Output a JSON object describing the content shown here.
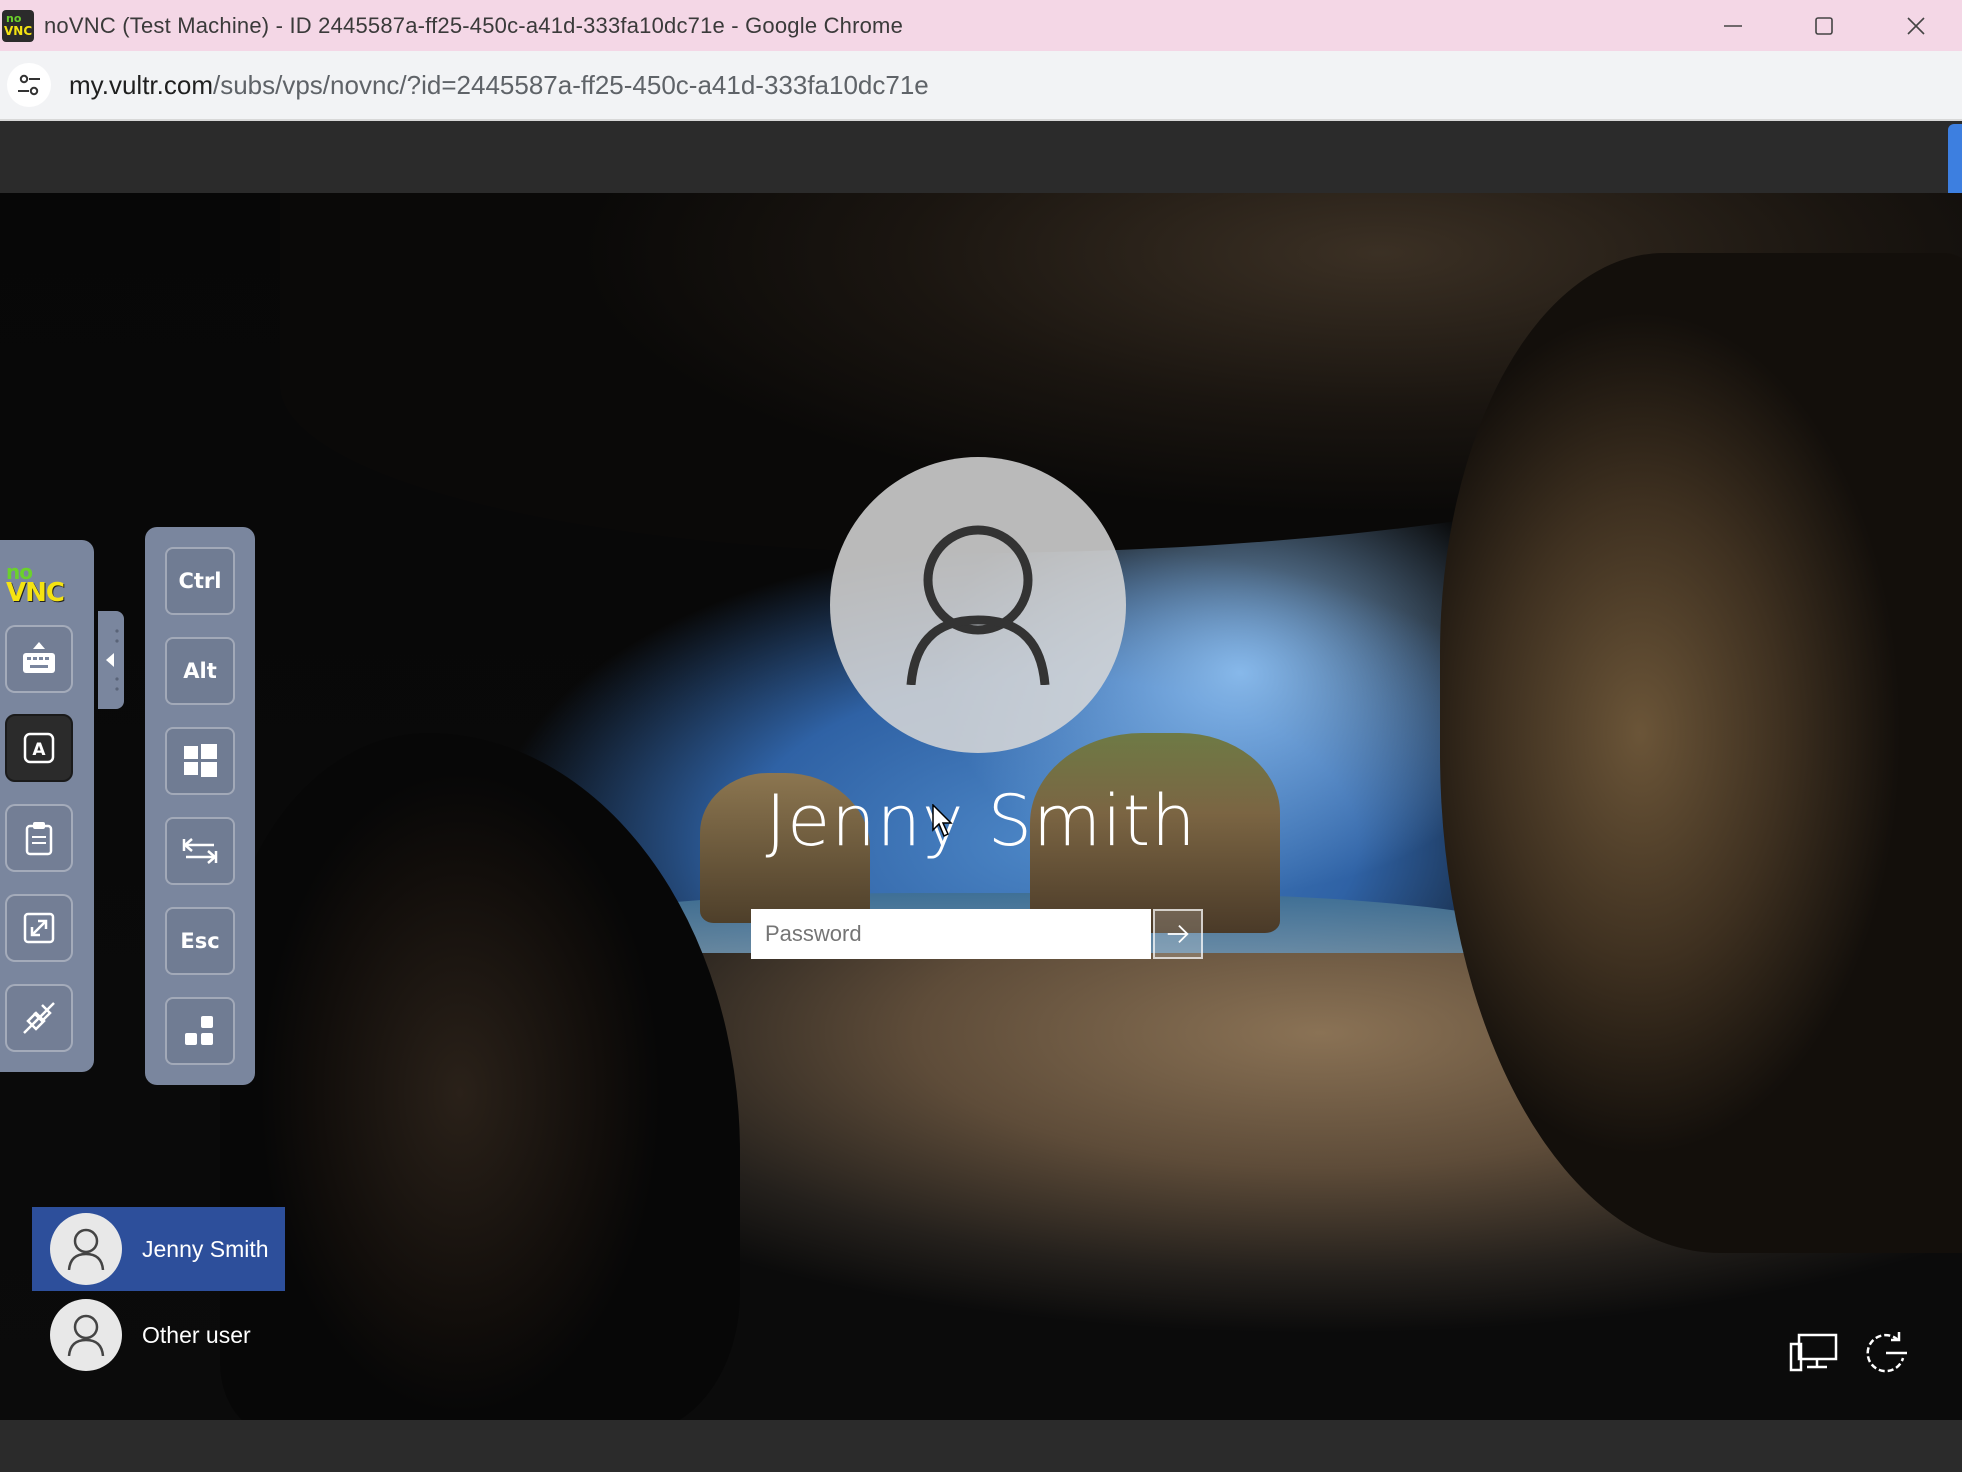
{
  "window": {
    "title": "noVNC (Test Machine) - ID 2445587a-ff25-450c-a41d-333fa10dc71e - Google Chrome",
    "favicon_top": "no",
    "favicon_bottom": "VNC"
  },
  "address_bar": {
    "host": "my.vultr.com",
    "path": "/subs/vps/novnc/?id=2445587a-ff25-450c-a41d-333fa10dc71e"
  },
  "novnc": {
    "logo_top": "no",
    "logo_bottom": "VNC",
    "control_bar": [
      {
        "icon": "keyboard-icon"
      },
      {
        "icon": "extra-keys-icon",
        "active": true
      },
      {
        "icon": "clipboard-icon"
      },
      {
        "icon": "fullscreen-icon"
      },
      {
        "icon": "disconnect-icon"
      }
    ],
    "extra_keys": {
      "ctrl": "Ctrl",
      "alt": "Alt",
      "windows": "windows-icon",
      "tab": "tab-icon",
      "esc": "Esc",
      "ctrl_alt_del": "ctrl-alt-del-icon"
    }
  },
  "login": {
    "user_name": "Jenny Smith",
    "password_placeholder": "Password",
    "submit_icon": "arrow-right-icon"
  },
  "users": [
    {
      "name": "Jenny Smith",
      "selected": true
    },
    {
      "name": "Other user",
      "selected": false
    }
  ],
  "bottom_right_icons": [
    "network-icon",
    "ease-of-access-icon"
  ],
  "colors": {
    "titlebar": "#f4d7e6",
    "selected_user": "#2d4f9b",
    "panel": "#7a869e"
  }
}
